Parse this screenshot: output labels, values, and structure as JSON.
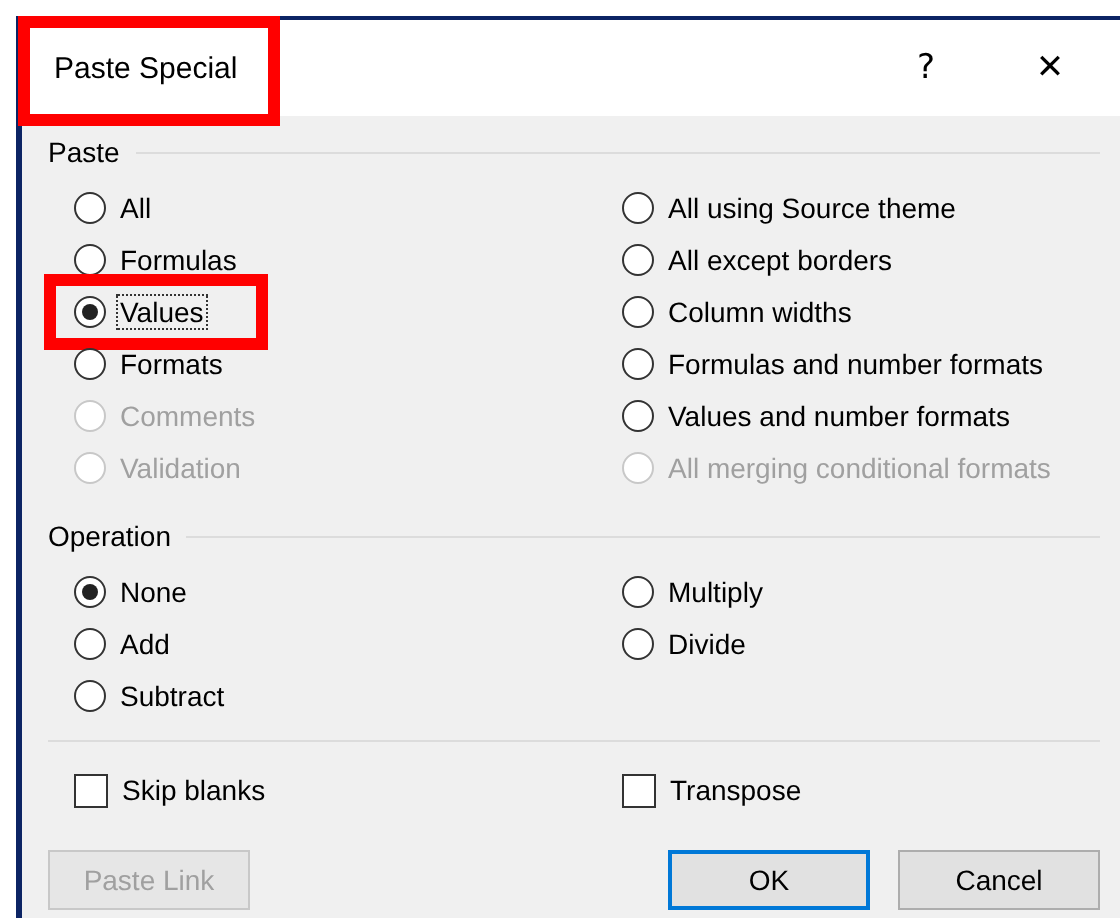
{
  "window": {
    "title": "Paste Special",
    "highlighted": true,
    "help": "?",
    "close": "✕"
  },
  "paste": {
    "label": "Paste",
    "options": [
      {
        "label": "All",
        "selected": false,
        "disabled": false,
        "highlighted": false
      },
      {
        "label": "All using Source theme",
        "selected": false,
        "disabled": false,
        "highlighted": false
      },
      {
        "label": "Formulas",
        "selected": false,
        "disabled": false,
        "highlighted": false
      },
      {
        "label": "All except borders",
        "selected": false,
        "disabled": false,
        "highlighted": false
      },
      {
        "label": "Values",
        "selected": true,
        "disabled": false,
        "highlighted": true
      },
      {
        "label": "Column widths",
        "selected": false,
        "disabled": false,
        "highlighted": false
      },
      {
        "label": "Formats",
        "selected": false,
        "disabled": false,
        "highlighted": false
      },
      {
        "label": "Formulas and number formats",
        "selected": false,
        "disabled": false,
        "highlighted": false
      },
      {
        "label": "Comments",
        "selected": false,
        "disabled": true,
        "highlighted": false
      },
      {
        "label": "Values and number formats",
        "selected": false,
        "disabled": false,
        "highlighted": false
      },
      {
        "label": "Validation",
        "selected": false,
        "disabled": true,
        "highlighted": false
      },
      {
        "label": "All merging conditional formats",
        "selected": false,
        "disabled": true,
        "highlighted": false
      }
    ]
  },
  "operation": {
    "label": "Operation",
    "options": [
      {
        "label": "None",
        "selected": true,
        "disabled": false
      },
      {
        "label": "Multiply",
        "selected": false,
        "disabled": false
      },
      {
        "label": "Add",
        "selected": false,
        "disabled": false
      },
      {
        "label": "Divide",
        "selected": false,
        "disabled": false
      },
      {
        "label": "Subtract",
        "selected": false,
        "disabled": false
      }
    ]
  },
  "checkboxes": [
    {
      "label": "Skip blanks",
      "checked": false
    },
    {
      "label": "Transpose",
      "checked": false
    }
  ],
  "buttons": [
    {
      "label": "Paste Link",
      "kind": "plain",
      "disabled": true
    },
    {
      "label": "OK",
      "kind": "default",
      "disabled": false
    },
    {
      "label": "Cancel",
      "kind": "plain",
      "disabled": false
    }
  ]
}
